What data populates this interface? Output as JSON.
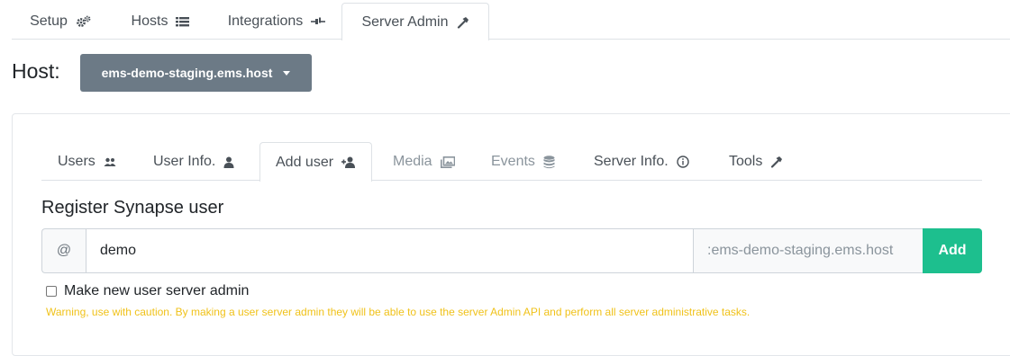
{
  "top_tabs": [
    {
      "label": "Setup",
      "icon": "gears-icon",
      "active": false
    },
    {
      "label": "Hosts",
      "icon": "list-icon",
      "active": false
    },
    {
      "label": "Integrations",
      "icon": "plug-icon",
      "active": false
    },
    {
      "label": "Server Admin",
      "icon": "hammer-icon",
      "active": true
    }
  ],
  "host": {
    "label": "Host:",
    "selected": "ems-demo-staging.ems.host"
  },
  "sub_tabs": [
    {
      "label": "Users",
      "icon": "users-icon",
      "state": "normal"
    },
    {
      "label": "User Info.",
      "icon": "user-icon",
      "state": "normal"
    },
    {
      "label": "Add user",
      "icon": "user-plus-icon",
      "state": "active"
    },
    {
      "label": "Media",
      "icon": "images-icon",
      "state": "disabled"
    },
    {
      "label": "Events",
      "icon": "database-icon",
      "state": "disabled"
    },
    {
      "label": "Server Info.",
      "icon": "info-circle-icon",
      "state": "normal"
    },
    {
      "label": "Tools",
      "icon": "hammer-icon",
      "state": "normal"
    }
  ],
  "form": {
    "title": "Register Synapse user",
    "prefix": "@",
    "username_value": "demo",
    "domain_suffix": ":ems-demo-staging.ems.host",
    "add_label": "Add",
    "admin_checkbox_label": "Make new user server admin",
    "admin_checked": false,
    "warning": "Warning, use with caution. By making a user server admin they will be able to use the server Admin API and perform all server administrative tasks."
  },
  "colors": {
    "accent_green": "#1dbf8e",
    "dropdown_gray": "#6c7a86",
    "warning_yellow": "#f0c21a"
  }
}
